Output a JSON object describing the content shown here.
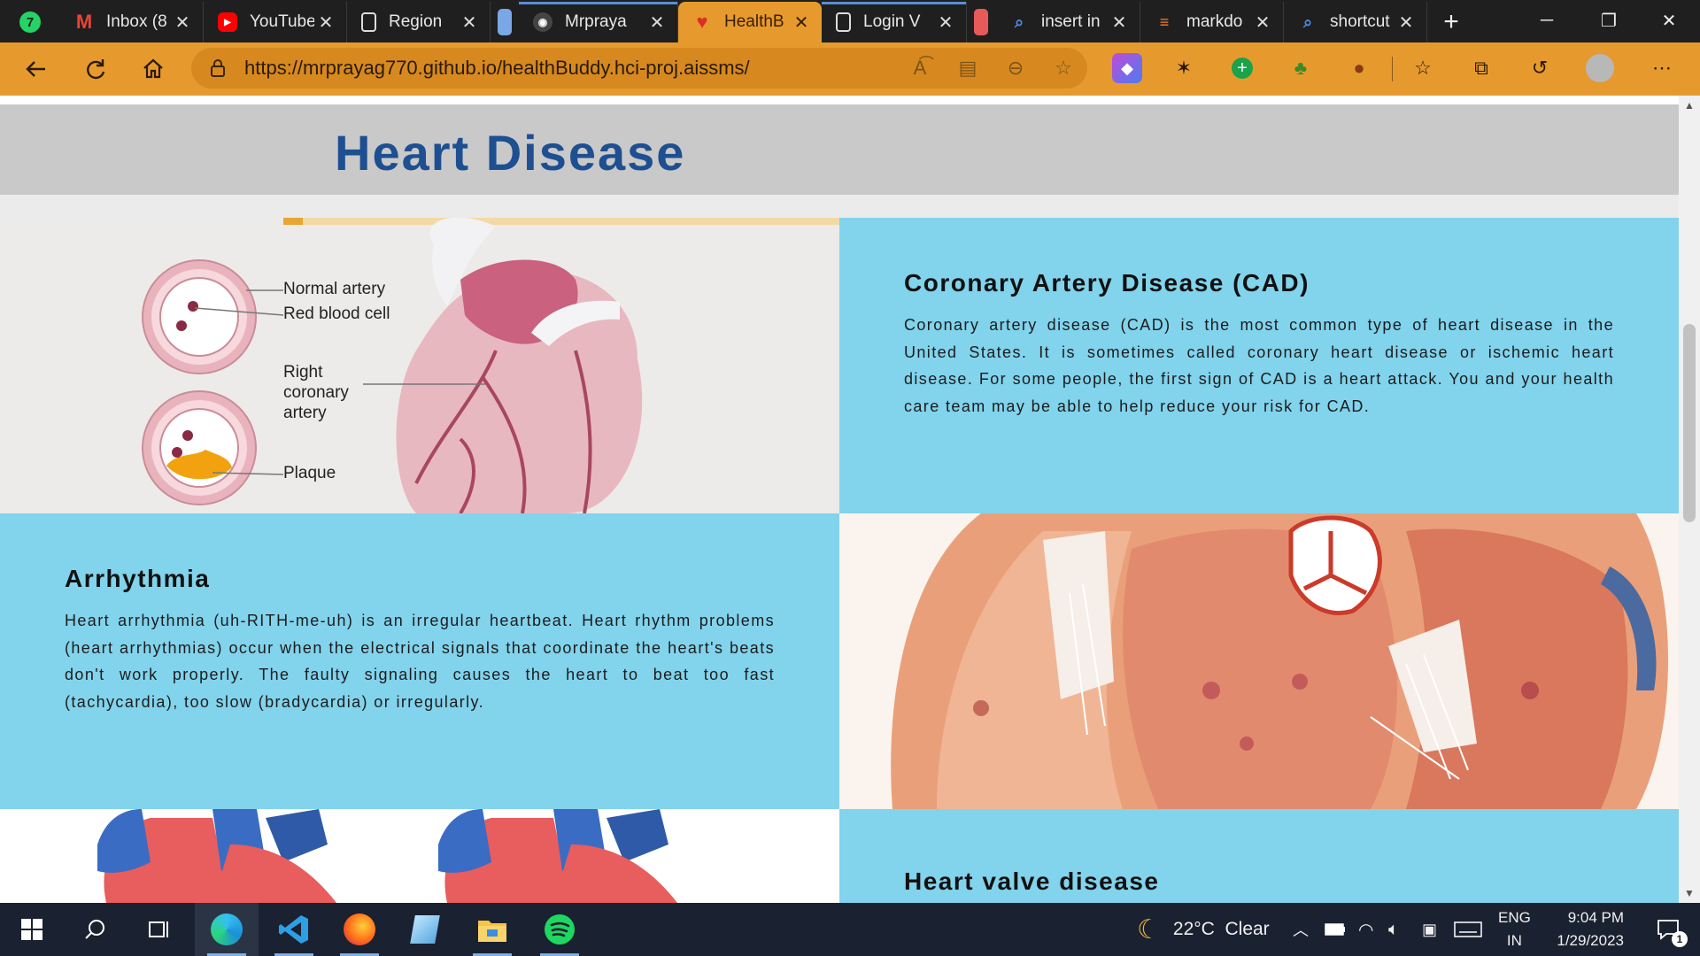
{
  "browser": {
    "tabs": [
      {
        "label": "Inbox (8",
        "icon": "gmail-icon",
        "color": "#ea4335"
      },
      {
        "label": "YouTube",
        "icon": "youtube-icon",
        "color": "#ff0000"
      },
      {
        "label": "Region",
        "icon": "document-icon",
        "color": "#dddddd"
      },
      {
        "label": "Mrpraya",
        "icon": "github-icon",
        "color": "#ffffff"
      },
      {
        "label": "HealthB",
        "icon": "heart-icon",
        "color": "#d93025"
      },
      {
        "label": "Login V",
        "icon": "document-icon",
        "color": "#dddddd"
      },
      {
        "label": "insert in",
        "icon": "search-icon",
        "color": "#1a73e8"
      },
      {
        "label": "markdo",
        "icon": "stackoverflow-icon",
        "color": "#f48024"
      },
      {
        "label": "shortcut",
        "icon": "search-icon",
        "color": "#1a73e8"
      }
    ],
    "active_tab": 4,
    "new_tab": "+",
    "window_controls": {
      "minimize": "─",
      "restore": "❐",
      "close": "✕"
    },
    "url": "https://mrprayag770.github.io/healthBuddy.hci-proj.aissms/",
    "accent": "#e69a2e"
  },
  "page": {
    "title": "Heart Disease",
    "cad": {
      "title": "Coronary Artery Disease (CAD)",
      "body": "Coronary artery disease (CAD) is the most common type of heart disease in the United States. It is sometimes called coronary heart disease or ischemic heart disease. For some people, the first sign of CAD is a heart attack. You and your health care team may be able to help reduce your risk for CAD."
    },
    "cad_image": {
      "labels": [
        "Normal artery",
        "Red blood cell",
        "Right",
        "coronary",
        "artery",
        "Plaque"
      ]
    },
    "arrhythmia": {
      "title": "Arrhythmia",
      "body": "Heart arrhythmia (uh-RITH-me-uh) is an irregular heartbeat. Heart rhythm problems (heart arrhythmias) occur when the electrical signals that coordinate the heart's beats don't work properly. The faulty signaling causes the heart to beat too fast (tachycardia), too slow (bradycardia) or irregularly."
    },
    "valve": {
      "title": "Heart valve disease"
    },
    "section_color": "#82d3ec",
    "title_color": "#1d4f91"
  },
  "taskbar": {
    "weather": "22°C  Clear",
    "lang_top": "ENG",
    "lang_bottom": "IN",
    "time": "9:04 PM",
    "date": "1/29/2023",
    "notifications": "1"
  }
}
